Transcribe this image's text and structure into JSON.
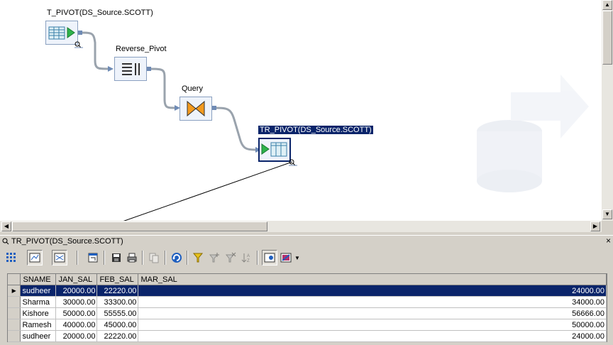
{
  "canvas": {
    "nodes": [
      {
        "label": "T_PIVOT(DS_Source.SCOTT)",
        "icon": "source-table-icon"
      },
      {
        "label": "Reverse_Pivot",
        "icon": "reverse-pivot-icon"
      },
      {
        "label": "Query",
        "icon": "query-transform-icon"
      },
      {
        "label": "TR_PIVOT(DS_Source.SCOTT)",
        "icon": "target-table-icon",
        "selected": true
      }
    ]
  },
  "panel": {
    "title": "TR_PIVOT(DS_Source.SCOTT)",
    "close_icon": "close-icon"
  },
  "toolbar": {
    "buttons": [
      "grid-view-icon",
      "show-data-icon",
      "show-diff-icon",
      "open-window-icon",
      "save-icon",
      "print-icon",
      "copy-icon",
      "refresh-icon",
      "filter-icon",
      "filter-add-icon",
      "filter-remove-icon",
      "sort-icon",
      "show-columns-icon",
      "highlight-icon",
      "dropdown-icon"
    ]
  },
  "grid": {
    "columns": [
      "SNAME",
      "JAN_SAL",
      "FEB_SAL",
      "MAR_SAL"
    ],
    "rows": [
      [
        "sudheer",
        "20000.00",
        "22220.00",
        "24000.00"
      ],
      [
        "Sharma",
        "30000.00",
        "33300.00",
        "34000.00"
      ],
      [
        "Kishore",
        "50000.00",
        "55555.00",
        "56666.00"
      ],
      [
        "Ramesh",
        "40000.00",
        "45000.00",
        "50000.00"
      ],
      [
        "sudheer",
        "20000.00",
        "22220.00",
        "24000.00"
      ]
    ],
    "selected_row": 0
  },
  "colors": {
    "selection": "#0a246a",
    "window_bg": "#d4d0c8",
    "node_border": "#8aa0c0"
  }
}
